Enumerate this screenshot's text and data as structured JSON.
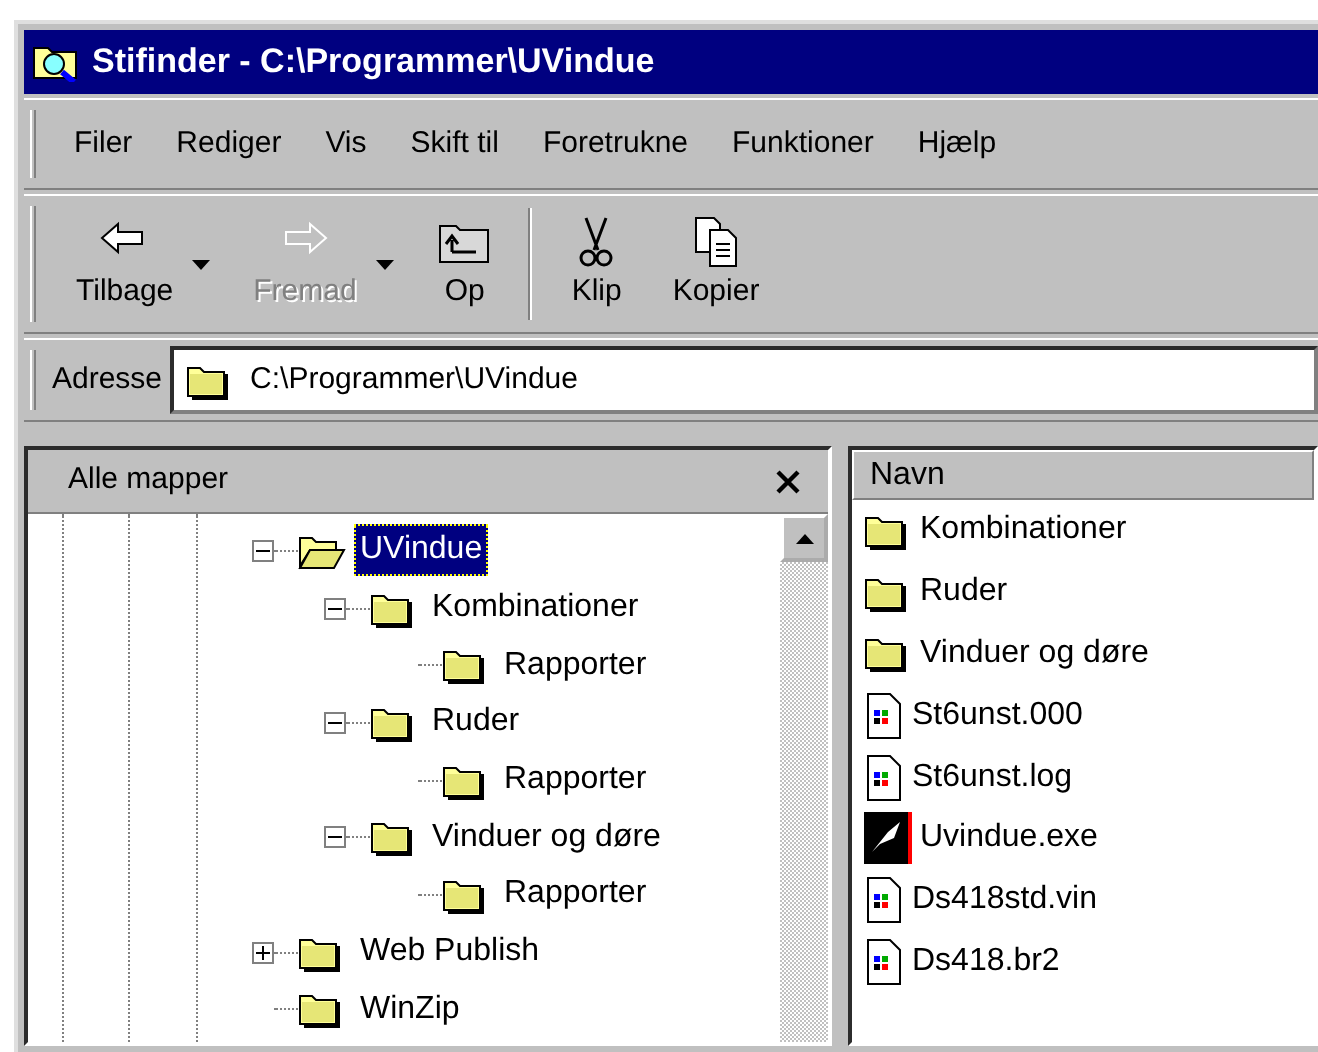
{
  "window": {
    "title": "Stifinder - C:\\Programmer\\UVindue"
  },
  "menu": [
    "Filer",
    "Rediger",
    "Vis",
    "Skift til",
    "Foretrukne",
    "Funktioner",
    "Hjælp"
  ],
  "toolbar": [
    {
      "kind": "back",
      "label": "Tilbage",
      "disabled": false,
      "dropdown": true
    },
    {
      "kind": "forward",
      "label": "Fremad",
      "disabled": true,
      "dropdown": true
    },
    {
      "kind": "up",
      "label": "Op",
      "disabled": false,
      "dropdown": false
    },
    {
      "kind": "separator"
    },
    {
      "kind": "cut",
      "label": "Klip",
      "disabled": false,
      "dropdown": false
    },
    {
      "kind": "copy",
      "label": "Kopier",
      "disabled": false,
      "dropdown": false
    }
  ],
  "address": {
    "label": "Adresse",
    "value": "C:\\Programmer\\UVindue"
  },
  "folders_pane": {
    "title": "Alle mapper",
    "tree": [
      {
        "name": "UVindue",
        "selected": true,
        "expanded": true,
        "children": [
          {
            "name": "Kombinationer",
            "selected": false,
            "expanded": true,
            "children": [
              {
                "name": "Rapporter",
                "selected": false
              }
            ]
          },
          {
            "name": "Ruder",
            "selected": false,
            "expanded": true,
            "children": [
              {
                "name": "Rapporter",
                "selected": false
              }
            ]
          },
          {
            "name": "Vinduer og døre",
            "selected": false,
            "expanded": true,
            "children": [
              {
                "name": "Rapporter",
                "selected": false
              }
            ]
          }
        ]
      },
      {
        "name": "Web Publish",
        "selected": false,
        "expanded": false
      },
      {
        "name": "WinZip",
        "selected": false
      }
    ]
  },
  "files_pane": {
    "columns": [
      "Navn"
    ],
    "items": [
      {
        "name": "Kombinationer",
        "kind": "folder"
      },
      {
        "name": "Ruder",
        "kind": "folder"
      },
      {
        "name": "Vinduer og døre",
        "kind": "folder"
      },
      {
        "name": "St6unst.000",
        "kind": "document"
      },
      {
        "name": "St6unst.log",
        "kind": "document"
      },
      {
        "name": "Uvindue.exe",
        "kind": "program"
      },
      {
        "name": "Ds418std.vin",
        "kind": "document"
      },
      {
        "name": "Ds418.br2",
        "kind": "document"
      }
    ]
  }
}
